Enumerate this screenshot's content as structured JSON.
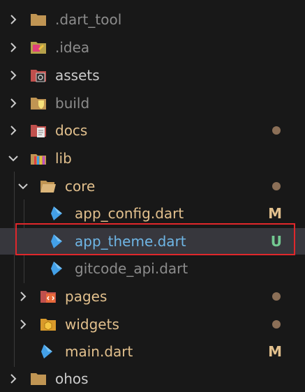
{
  "colors": {
    "folder": "#dcb67a",
    "muted_text": "#8c8c8c",
    "modified_text": "#e2c08d",
    "untracked_text": "#73c991",
    "selected_text": "#6fb6e6",
    "dot": "#8b6f57",
    "highlight": "#e0272b",
    "dart": "#43a0e8"
  },
  "tree": [
    {
      "label": ".dart_tool",
      "icon": "folder-icon",
      "expanded": false,
      "status": ""
    },
    {
      "label": ".idea",
      "icon": "idea-folder-icon",
      "expanded": false,
      "status": ""
    },
    {
      "label": "assets",
      "icon": "assets-folder-icon",
      "expanded": false,
      "status": ""
    },
    {
      "label": "build",
      "icon": "build-folder-icon",
      "expanded": false,
      "status": ""
    },
    {
      "label": "docs",
      "icon": "docs-folder-icon",
      "expanded": false,
      "status": "dot"
    },
    {
      "label": "lib",
      "icon": "lib-folder-icon",
      "expanded": true,
      "status": ""
    },
    {
      "label": "core",
      "icon": "open-folder-icon",
      "expanded": true,
      "status": "dot"
    },
    {
      "label": "app_config.dart",
      "icon": "dart-icon",
      "status": "M"
    },
    {
      "label": "app_theme.dart",
      "icon": "dart-icon",
      "status": "U"
    },
    {
      "label": "gitcode_api.dart",
      "icon": "dart-icon",
      "status": ""
    },
    {
      "label": "pages",
      "icon": "pages-folder-icon",
      "expanded": false,
      "status": "dot"
    },
    {
      "label": "widgets",
      "icon": "widgets-folder-icon",
      "expanded": false,
      "status": "dot"
    },
    {
      "label": "main.dart",
      "icon": "dart-icon",
      "status": "M"
    },
    {
      "label": "ohos",
      "icon": "folder-icon",
      "expanded": false,
      "status": ""
    }
  ]
}
